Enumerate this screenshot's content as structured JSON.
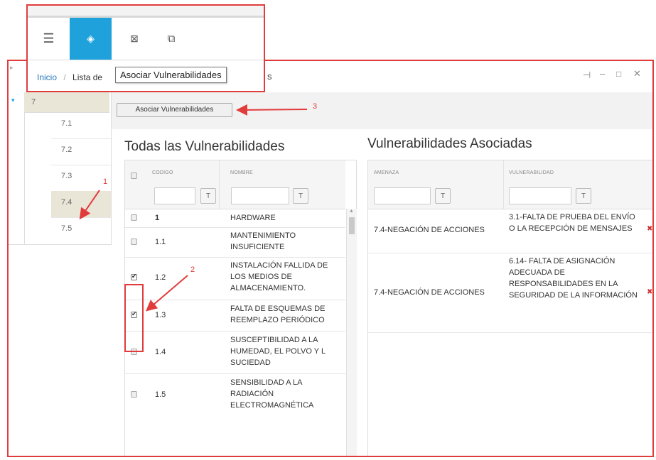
{
  "toolbar": {
    "icons": [
      "menu-icon",
      "target-icon",
      "excel-icon",
      "copy-icon"
    ],
    "accent": "#1fa2dc"
  },
  "breadcrumb": {
    "home": "Inicio",
    "separator": "/",
    "current": "Lista de"
  },
  "tooltip": "Asociar Vulnerabilidades",
  "header_fragment": "s",
  "window_controls": [
    "⊣",
    "–",
    "□",
    "✕"
  ],
  "tree": {
    "root": "7",
    "items": [
      "7.1",
      "7.2",
      "7.3",
      "7.4",
      "7.5"
    ],
    "selected": "7.4"
  },
  "associate_button": "Asociar Vulnerabilidades",
  "annotations": {
    "a1": "1",
    "a2": "2",
    "a3": "3"
  },
  "left_panel": {
    "title": "Todas las Vulnerabilidades",
    "col_code": "CODIGO",
    "col_name": "NOMBRE",
    "rows": [
      {
        "code": "1",
        "name": "HARDWARE",
        "checked": false
      },
      {
        "code": "1.1",
        "name": "MANTENIMIENTO INSUFICIENTE",
        "checked": false
      },
      {
        "code": "1.2",
        "name": "INSTALACIÓN FALLIDA DE LOS MEDIOS DE ALMACENAMIENTO.",
        "checked": true
      },
      {
        "code": "1.3",
        "name": "FALTA DE ESQUEMAS DE REEMPLAZO PERIÓDICO",
        "checked": true
      },
      {
        "code": "1.4",
        "name": "SUSCEPTIBILIDAD A LA HUMEDAD, EL POLVO Y L SUCIEDAD",
        "checked": false
      },
      {
        "code": "1.5",
        "name": "SENSIBILIDAD A LA RADIACIÓN ELECTROMAGNÉTICA",
        "checked": false
      }
    ]
  },
  "right_panel": {
    "title": "Vulnerabilidades Asociadas",
    "col_threat": "AMENAZA",
    "col_vuln": "VULNERABILIDAD",
    "rows": [
      {
        "threat": "7.4-NEGACIÓN DE ACCIONES",
        "vuln": "3.1-FALTA DE PRUEBA DEL ENVÍO O LA RECEPCIÓN DE MENSAJES",
        "remove": "✖"
      },
      {
        "threat": "7.4-NEGACIÓN DE ACCIONES",
        "vuln": "6.14- FALTA DE ASIGNACIÓN ADECUADA DE RESPONSABILIDADES EN LA SEGURIDAD DE LA INFORMACIÓN",
        "remove": "✖"
      }
    ]
  },
  "filter_icon": "T"
}
